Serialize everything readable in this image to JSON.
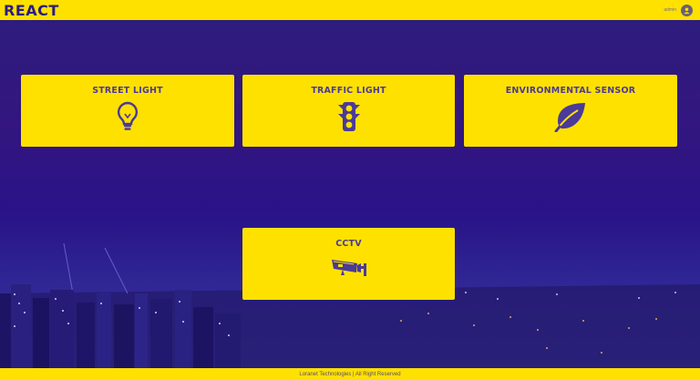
{
  "header": {
    "logo": "REACT",
    "user": "admin"
  },
  "cards": [
    {
      "title": "STREET LIGHT",
      "icon": "light-bulb-icon"
    },
    {
      "title": "TRAFFIC LIGHT",
      "icon": "traffic-light-icon"
    },
    {
      "title": "ENVIRONMENTAL SENSOR",
      "icon": "leaf-icon"
    },
    {
      "title": "CCTV",
      "icon": "cctv-camera-icon"
    }
  ],
  "footer": {
    "text": "Loranet Technologies | All Right Reserved"
  },
  "colors": {
    "accent": "#ffe100",
    "primary": "#2b1d80"
  }
}
